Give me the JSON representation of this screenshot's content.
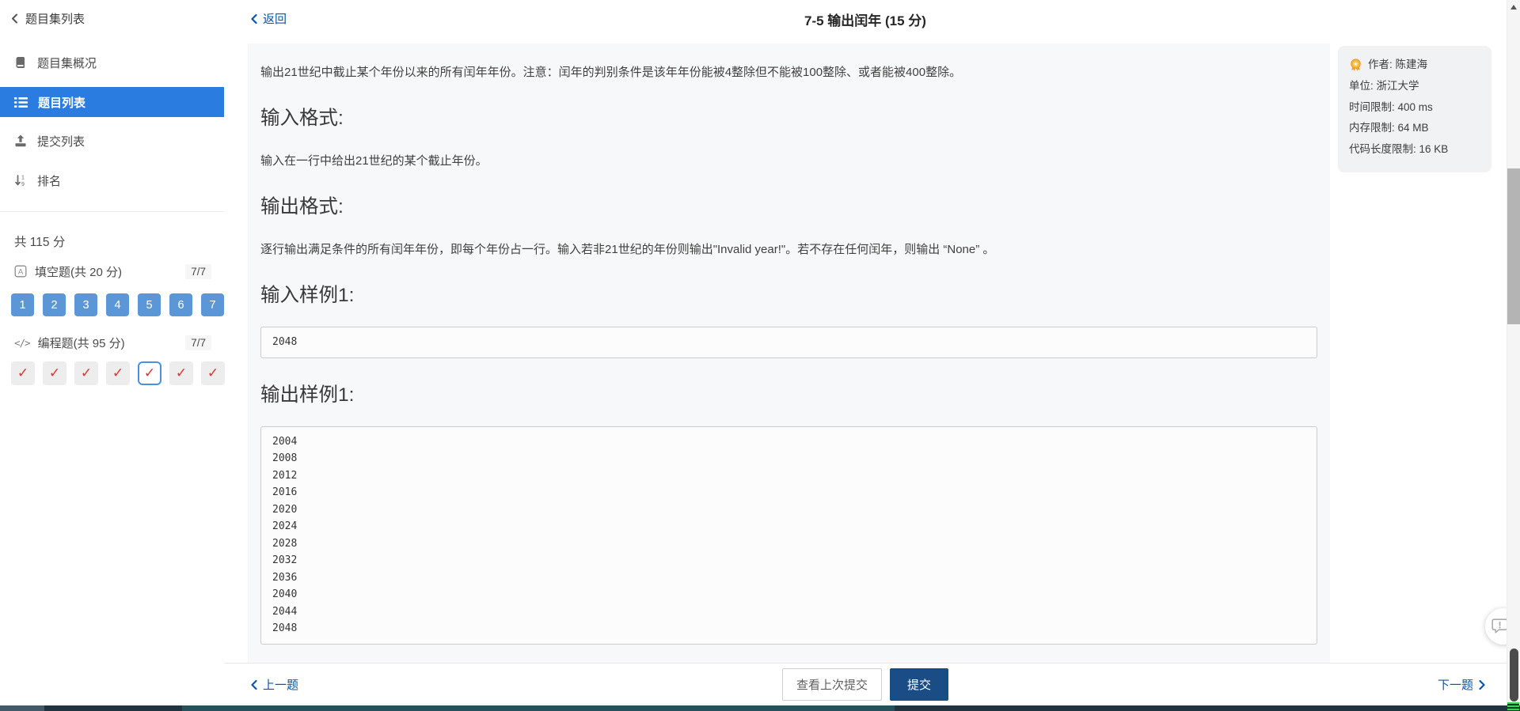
{
  "sidebar": {
    "back_label": "题目集列表",
    "items": [
      {
        "label": "题目集概况"
      },
      {
        "label": "题目列表"
      },
      {
        "label": "提交列表"
      },
      {
        "label": "排名"
      }
    ],
    "total_score": "共 115 分",
    "fill_blank": {
      "label": "填空题(共 20 分)",
      "progress": "7/7",
      "numbers": [
        "1",
        "2",
        "3",
        "4",
        "5",
        "6",
        "7"
      ]
    },
    "programming": {
      "label": "编程题(共 95 分)",
      "progress": "7/7",
      "check_glyph": "✓",
      "current_index": 5
    }
  },
  "header": {
    "back_label": "返回",
    "title": "7-5 输出闰年 (15 分)"
  },
  "problem": {
    "description": "输出21世纪中截止某个年份以来的所有闰年年份。注意：闰年的判别条件是该年年份能被4整除但不能被100整除、或者能被400整除。",
    "input_format": {
      "heading": "输入格式:",
      "body": "输入在一行中给出21世纪的某个截止年份。"
    },
    "output_format": {
      "heading": "输出格式:",
      "body": "逐行输出满足条件的所有闰年年份，即每个年份占一行。输入若非21世纪的年份则输出\"Invalid year!\"。若不存在任何闰年，则输出 “None” 。"
    },
    "sample_input": {
      "heading": "输入样例1:",
      "code": "2048"
    },
    "sample_output": {
      "heading": "输出样例1:",
      "lines": [
        "2004",
        "2008",
        "2012",
        "2016",
        "2020",
        "2024",
        "2028",
        "2032",
        "2036",
        "2040",
        "2044",
        "2048"
      ]
    }
  },
  "info_panel": {
    "author": "作者: 陈建海",
    "unit": "单位: 浙江大学",
    "time_limit": "时间限制: 400 ms",
    "memory_limit": "内存限制: 64 MB",
    "code_length_limit": "代码长度限制: 16 KB"
  },
  "footer": {
    "prev_label": "上一题",
    "view_last_label": "查看上次提交",
    "submit_label": "提交",
    "next_label": "下一题"
  },
  "colors": {
    "link_blue": "#0b56a7",
    "selected_item_blue": "#2a7ce0",
    "number_button_blue": "#5b96d6",
    "check_red": "#e0322b",
    "submit_navy": "#1a4c86",
    "card_background": "#f7f8f9",
    "taskbar_dark": "#20333f"
  }
}
